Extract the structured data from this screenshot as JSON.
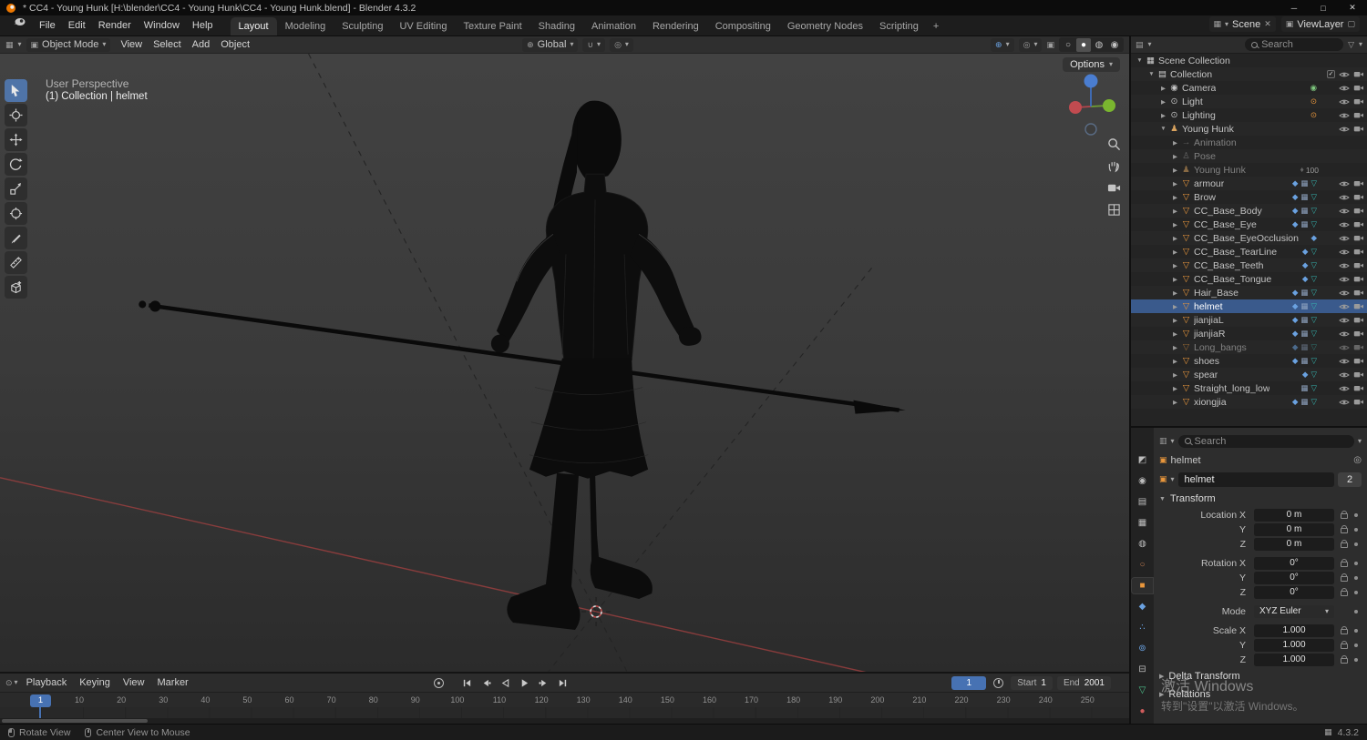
{
  "colors": {
    "accent_blue": "#4772b3",
    "object_orange": "#e8963c",
    "mesh_teal": "#35b5b0",
    "modifier_blue": "#6aa1e0",
    "selected_row_blue": "#3a5a8c"
  },
  "title_bar": {
    "title": "* CC4 - Young Hunk [H:\\blender\\CC4 - Young Hunk\\CC4 - Young Hunk.blend] - Blender 4.3.2",
    "minimize": "─",
    "maximize": "□",
    "close": "✕"
  },
  "topbar": {
    "menus": [
      {
        "label": "File"
      },
      {
        "label": "Edit"
      },
      {
        "label": "Render"
      },
      {
        "label": "Window"
      },
      {
        "label": "Help"
      }
    ],
    "workspaces": [
      {
        "label": "Layout",
        "active": "true"
      },
      {
        "label": "Modeling",
        "active": "false"
      },
      {
        "label": "Sculpting",
        "active": "false"
      },
      {
        "label": "UV Editing",
        "active": "false"
      },
      {
        "label": "Texture Paint",
        "active": "false"
      },
      {
        "label": "Shading",
        "active": "false"
      },
      {
        "label": "Animation",
        "active": "false"
      },
      {
        "label": "Rendering",
        "active": "false"
      },
      {
        "label": "Compositing",
        "active": "false"
      },
      {
        "label": "Geometry Nodes",
        "active": "false"
      },
      {
        "label": "Scripting",
        "active": "false"
      }
    ],
    "add_workspace_label": "+",
    "scene_label": "Scene",
    "viewlayer_label": "ViewLayer"
  },
  "tool_header": {
    "mode_label": "Object Mode",
    "menus": [
      {
        "label": "View"
      },
      {
        "label": "Select"
      },
      {
        "label": "Add"
      },
      {
        "label": "Object"
      }
    ],
    "orientation_label": "Global",
    "shading_modes": [
      "wireframe",
      "solid",
      "material",
      "rendered"
    ],
    "active_shading": "solid"
  },
  "toolbar": {
    "tools": [
      "tweak-select",
      "cursor",
      "move",
      "rotate",
      "scale",
      "transform",
      "annotate",
      "measure",
      "add-cube"
    ],
    "active_tool": "tweak-select"
  },
  "viewport": {
    "perspective_label": "User Perspective",
    "context_label": "(1) Collection | helmet",
    "options_label": "Options"
  },
  "outliner": {
    "search_placeholder": "Search",
    "items": [
      {
        "label": "Scene Collection",
        "depth": 0,
        "icon": "scene",
        "expand": "open",
        "state": "normal",
        "vis": "none",
        "badges": "",
        "badge_text": ""
      },
      {
        "label": "Collection",
        "depth": 1,
        "icon": "collection",
        "expand": "open",
        "state": "normal",
        "vis": "cec",
        "badges": "",
        "badge_text": ""
      },
      {
        "label": "Camera",
        "depth": 2,
        "icon": "camera",
        "expand": "closed",
        "state": "normal",
        "vis": "ec",
        "badges": "camdata",
        "badge_text": ""
      },
      {
        "label": "Light",
        "depth": 2,
        "icon": "light",
        "expand": "closed",
        "state": "normal",
        "vis": "ec",
        "badges": "lightdata",
        "badge_text": ""
      },
      {
        "label": "Lighting",
        "depth": 2,
        "icon": "light",
        "expand": "closed",
        "state": "normal",
        "vis": "ec",
        "badges": "lightdata",
        "badge_text": ""
      },
      {
        "label": "Young Hunk",
        "depth": 2,
        "icon": "armature",
        "expand": "open",
        "state": "normal",
        "vis": "ec",
        "badges": "",
        "badge_text": ""
      },
      {
        "label": "Animation",
        "depth": 3,
        "icon": "action",
        "expand": "closed",
        "state": "dim",
        "vis": "none",
        "badges": "",
        "badge_text": ""
      },
      {
        "label": "Pose",
        "depth": 3,
        "icon": "pose",
        "expand": "closed",
        "state": "dim",
        "vis": "none",
        "badges": "",
        "badge_text": ""
      },
      {
        "label": "Young Hunk",
        "depth": 3,
        "icon": "armature",
        "expand": "closed",
        "state": "dim",
        "vis": "none",
        "badges": "anim",
        "badge_text": "100"
      },
      {
        "label": "armour",
        "depth": 3,
        "icon": "mesh",
        "expand": "closed",
        "state": "normal",
        "vis": "ec",
        "badges": "mod grid mesh",
        "badge_text": ""
      },
      {
        "label": "Brow",
        "depth": 3,
        "icon": "mesh",
        "expand": "closed",
        "state": "normal",
        "vis": "ec",
        "badges": "mod grid mesh",
        "badge_text": ""
      },
      {
        "label": "CC_Base_Body",
        "depth": 3,
        "icon": "mesh",
        "expand": "closed",
        "state": "normal",
        "vis": "ec",
        "badges": "mod grid mesh",
        "badge_text": ""
      },
      {
        "label": "CC_Base_Eye",
        "depth": 3,
        "icon": "mesh",
        "expand": "closed",
        "state": "normal",
        "vis": "ec",
        "badges": "mod grid mesh",
        "badge_text": ""
      },
      {
        "label": "CC_Base_EyeOcclusion",
        "depth": 3,
        "icon": "mesh",
        "expand": "closed",
        "state": "normal",
        "vis": "ec",
        "badges": "mod",
        "badge_text": ""
      },
      {
        "label": "CC_Base_TearLine",
        "depth": 3,
        "icon": "mesh",
        "expand": "closed",
        "state": "normal",
        "vis": "ec",
        "badges": "mod mesh",
        "badge_text": ""
      },
      {
        "label": "CC_Base_Teeth",
        "depth": 3,
        "icon": "mesh",
        "expand": "closed",
        "state": "normal",
        "vis": "ec",
        "badges": "mod mesh",
        "badge_text": ""
      },
      {
        "label": "CC_Base_Tongue",
        "depth": 3,
        "icon": "mesh",
        "expand": "closed",
        "state": "normal",
        "vis": "ec",
        "badges": "mod mesh",
        "badge_text": ""
      },
      {
        "label": "Hair_Base",
        "depth": 3,
        "icon": "mesh",
        "expand": "closed",
        "state": "normal",
        "vis": "ec",
        "badges": "mod grid mesh",
        "badge_text": ""
      },
      {
        "label": "helmet",
        "depth": 3,
        "icon": "mesh",
        "expand": "closed",
        "state": "selected",
        "vis": "ec",
        "badges": "mod grid mesh",
        "badge_text": ""
      },
      {
        "label": "jianjiaL",
        "depth": 3,
        "icon": "mesh",
        "expand": "closed",
        "state": "normal",
        "vis": "ec",
        "badges": "mod grid mesh",
        "badge_text": ""
      },
      {
        "label": "jianjiaR",
        "depth": 3,
        "icon": "mesh",
        "expand": "closed",
        "state": "normal",
        "vis": "ec",
        "badges": "mod grid mesh",
        "badge_text": ""
      },
      {
        "label": "Long_bangs",
        "depth": 3,
        "icon": "mesh",
        "expand": "closed",
        "state": "dim",
        "vis": "ec",
        "badges": "mod grid mesh",
        "badge_text": ""
      },
      {
        "label": "shoes",
        "depth": 3,
        "icon": "mesh",
        "expand": "closed",
        "state": "normal",
        "vis": "ec",
        "badges": "mod grid mesh",
        "badge_text": ""
      },
      {
        "label": "spear",
        "depth": 3,
        "icon": "mesh",
        "expand": "closed",
        "state": "normal",
        "vis": "ec",
        "badges": "mod mesh",
        "badge_text": ""
      },
      {
        "label": "Straight_long_low",
        "depth": 3,
        "icon": "mesh",
        "expand": "closed",
        "state": "normal",
        "vis": "ec",
        "badges": "grid mesh",
        "badge_text": ""
      },
      {
        "label": "xiongjia",
        "depth": 3,
        "icon": "mesh",
        "expand": "closed",
        "state": "normal",
        "vis": "ec",
        "badges": "mod grid mesh",
        "badge_text": ""
      }
    ]
  },
  "properties": {
    "search_placeholder": "Search",
    "tabs": [
      {
        "name": "tool",
        "glyph": "◩",
        "style": "color:#bdbdbd",
        "active": "false"
      },
      {
        "name": "render",
        "glyph": "◉",
        "style": "color:#bdbdbd",
        "active": "false"
      },
      {
        "name": "output",
        "glyph": "▤",
        "style": "color:#bdbdbd",
        "active": "false"
      },
      {
        "name": "view-layer",
        "glyph": "▦",
        "style": "color:#bdbdbd",
        "active": "false"
      },
      {
        "name": "scene",
        "glyph": "◍",
        "style": "color:#bdbdbd",
        "active": "false"
      },
      {
        "name": "world",
        "glyph": "○",
        "style": "color:#c77f52",
        "active": "false"
      },
      {
        "name": "object",
        "glyph": "■",
        "style": "color:#e8963c",
        "active": "true"
      },
      {
        "name": "modifiers",
        "glyph": "◆",
        "style": "color:#6aa1e0",
        "active": "false"
      },
      {
        "name": "particles",
        "glyph": "∴",
        "style": "color:#6aa1e0",
        "active": "false"
      },
      {
        "name": "physics",
        "glyph": "⊚",
        "style": "color:#6aa1e0",
        "active": "false"
      },
      {
        "name": "constraints",
        "glyph": "⊟",
        "style": "color:#bdbdbd",
        "active": "false"
      },
      {
        "name": "data",
        "glyph": "▽",
        "style": "color:#4fc78f",
        "active": "false"
      },
      {
        "name": "material",
        "glyph": "●",
        "style": "color:#cf5c5c",
        "active": "false"
      }
    ],
    "breadcrumb_object": "helmet",
    "name_value": "helmet",
    "users_count": "2",
    "transform_section": "Transform",
    "transform_rows": [
      {
        "label": "Location X",
        "value": "0 m",
        "kind": "num",
        "gap": "n"
      },
      {
        "label": "Y",
        "value": "0 m",
        "kind": "num",
        "gap": "n"
      },
      {
        "label": "Z",
        "value": "0 m",
        "kind": "num",
        "gap": "n"
      },
      {
        "label": "Rotation X",
        "value": "0°",
        "kind": "num",
        "gap": "y"
      },
      {
        "label": "Y",
        "value": "0°",
        "kind": "num",
        "gap": "n"
      },
      {
        "label": "Z",
        "value": "0°",
        "kind": "num",
        "gap": "n"
      },
      {
        "label": "Mode",
        "value": "XYZ Euler",
        "kind": "drop",
        "gap": "y"
      },
      {
        "label": "Scale X",
        "value": "1.000",
        "kind": "num",
        "gap": "y"
      },
      {
        "label": "Y",
        "value": "1.000",
        "kind": "num",
        "gap": "n"
      },
      {
        "label": "Z",
        "value": "1.000",
        "kind": "num",
        "gap": "n"
      }
    ],
    "collapsed_sections": [
      {
        "label": "Delta Transform"
      },
      {
        "label": "Relations"
      }
    ]
  },
  "timeline": {
    "menus": [
      {
        "label": "Playback"
      },
      {
        "label": "Keying"
      },
      {
        "label": "View"
      },
      {
        "label": "Marker"
      }
    ],
    "transport_buttons": [
      "jump-to-start",
      "jump-to-prev-keyframe",
      "play-reverse",
      "play",
      "jump-to-next-keyframe",
      "jump-to-end"
    ],
    "current_frame": "1",
    "start_label": "Start",
    "start_value": "1",
    "end_label": "End",
    "end_value": "2001",
    "ticks": [
      {
        "v": "10"
      },
      {
        "v": "20"
      },
      {
        "v": "30"
      },
      {
        "v": "40"
      },
      {
        "v": "50"
      },
      {
        "v": "60"
      },
      {
        "v": "70"
      },
      {
        "v": "80"
      },
      {
        "v": "90"
      },
      {
        "v": "100"
      },
      {
        "v": "110"
      },
      {
        "v": "120"
      },
      {
        "v": "130"
      },
      {
        "v": "140"
      },
      {
        "v": "150"
      },
      {
        "v": "160"
      },
      {
        "v": "170"
      },
      {
        "v": "180"
      },
      {
        "v": "190"
      },
      {
        "v": "200"
      },
      {
        "v": "210"
      },
      {
        "v": "220"
      },
      {
        "v": "230"
      },
      {
        "v": "240"
      },
      {
        "v": "250"
      }
    ]
  },
  "status_bar": {
    "hint_rotate": "Rotate View",
    "hint_center": "Center View to Mouse",
    "version": "4.3.2"
  },
  "watermark": {
    "line1": "激活 Windows",
    "line2": "转到\"设置\"以激活 Windows。"
  }
}
